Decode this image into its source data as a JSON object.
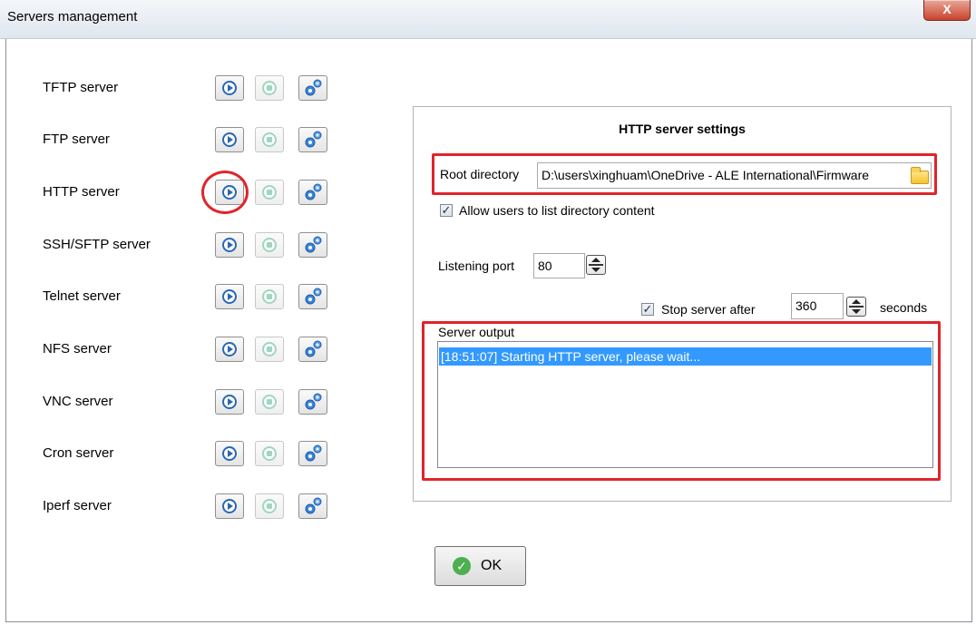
{
  "window": {
    "title": "Servers management",
    "close_label": "X"
  },
  "servers": [
    {
      "label": "TFTP server"
    },
    {
      "label": "FTP server"
    },
    {
      "label": "HTTP server"
    },
    {
      "label": "SSH/SFTP server"
    },
    {
      "label": "Telnet server"
    },
    {
      "label": "NFS server"
    },
    {
      "label": "VNC server"
    },
    {
      "label": "Cron server"
    },
    {
      "label": "Iperf server"
    }
  ],
  "server_buttons": {
    "start_icon": "play-icon",
    "stop_icon": "stop-icon",
    "settings_icon": "gears-icon"
  },
  "settings": {
    "title": "HTTP server settings",
    "root_directory_label": "Root directory",
    "root_directory_value": "D:\\users\\xinghuam\\OneDrive - ALE International\\Firmware",
    "allow_list_label": "Allow users to list directory content",
    "allow_list_checked": true,
    "listening_port_label": "Listening port",
    "listening_port_value": "80",
    "stop_after_label": "Stop server after",
    "stop_after_checked": true,
    "stop_after_value": "360",
    "seconds_label": "seconds",
    "output_label": "Server output",
    "output_lines": [
      "[18:51:07] Starting HTTP server, please wait..."
    ]
  },
  "ok_button": {
    "label": "OK"
  },
  "colors": {
    "highlight_red": "#e0242b",
    "selection_blue": "#3399ff",
    "play_blue": "#2a68b5",
    "ok_green": "#4caf50"
  }
}
